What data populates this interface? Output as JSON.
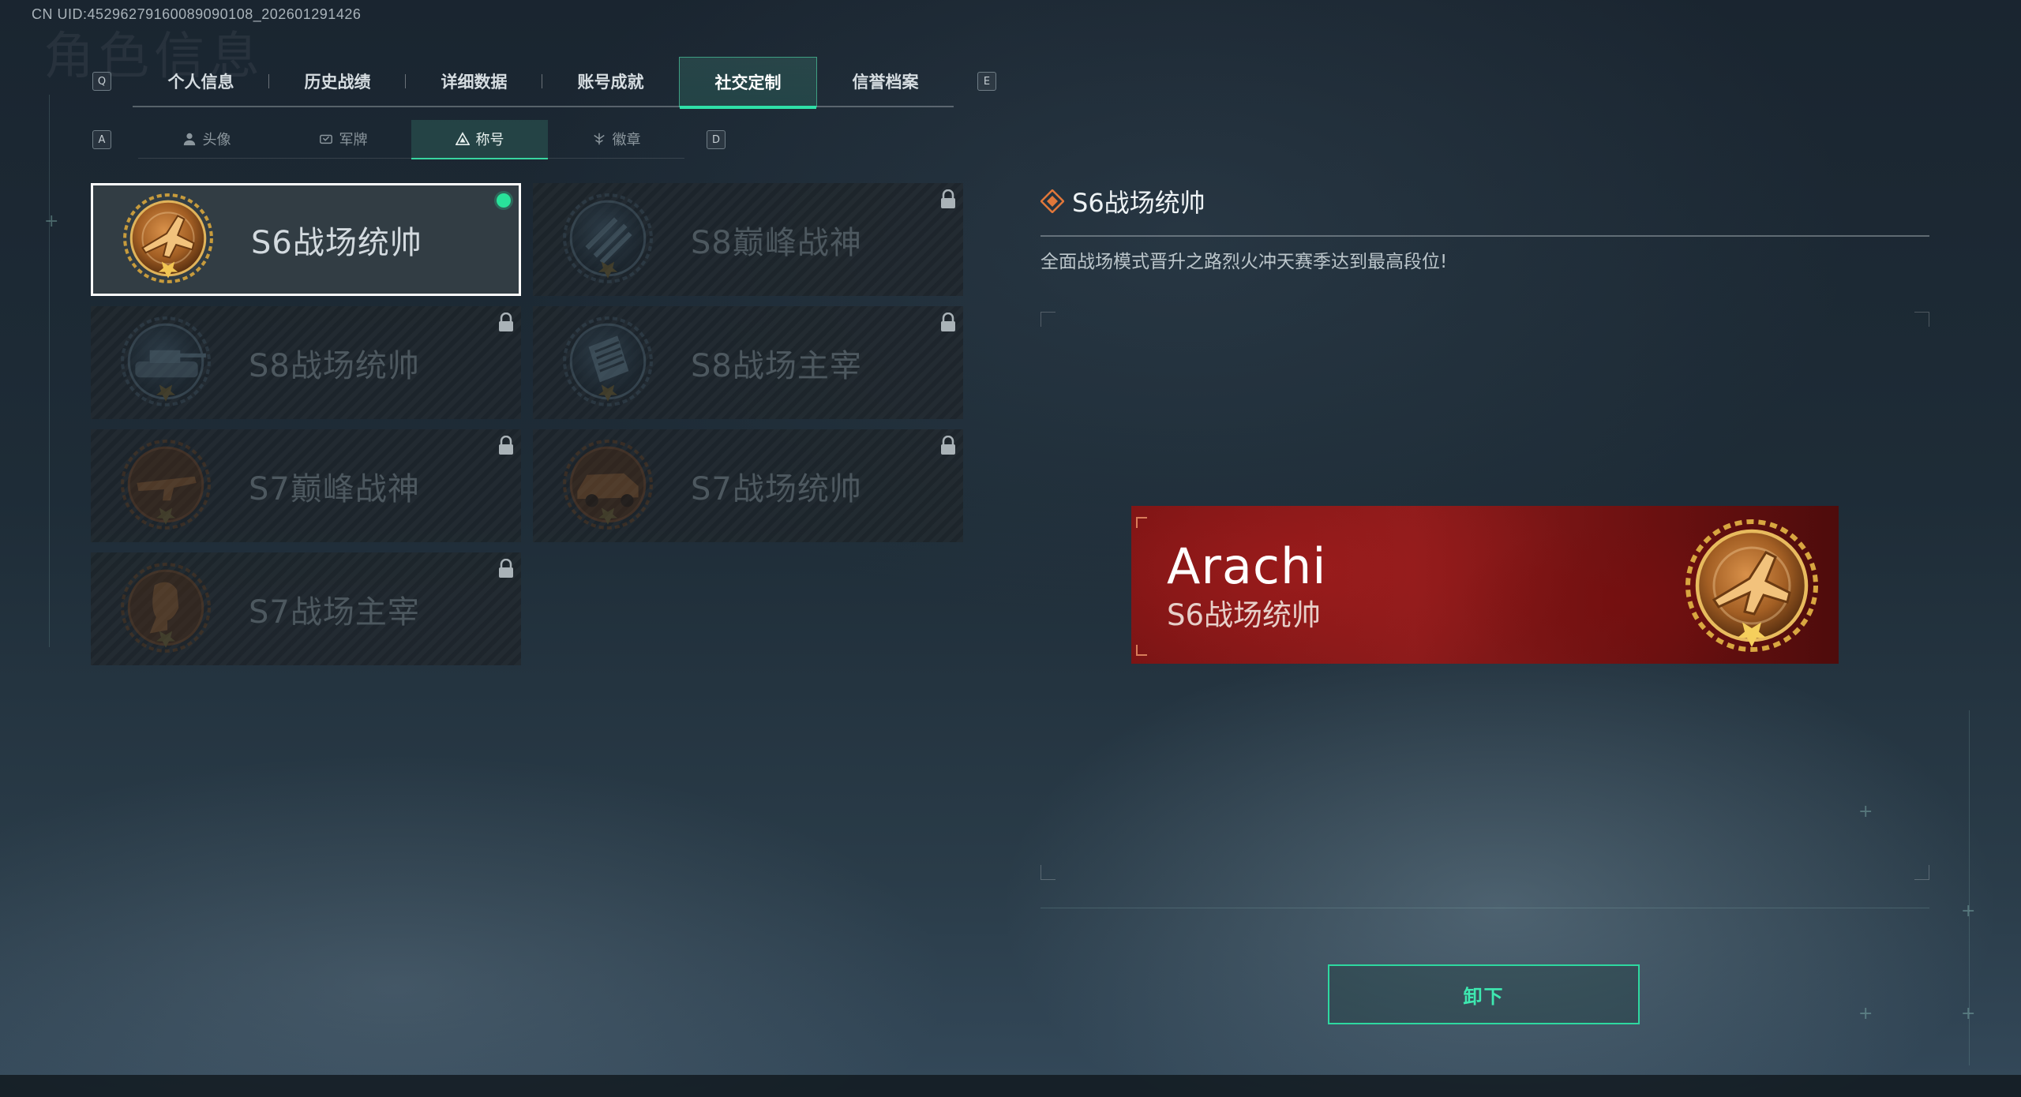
{
  "uid_text": "CN UID:4529627916008909010​8_202601291426",
  "watermark": "角色信息",
  "key_hints": {
    "prev_tab": "Q",
    "next_tab": "E",
    "prev_sub": "A",
    "next_sub": "D"
  },
  "tabs": [
    {
      "label": "个人信息"
    },
    {
      "label": "历史战绩"
    },
    {
      "label": "详细数据"
    },
    {
      "label": "账号成就"
    },
    {
      "label": "社交定制"
    },
    {
      "label": "信誉档案"
    }
  ],
  "subtabs": [
    {
      "label": "头像",
      "icon": "person-icon"
    },
    {
      "label": "军牌",
      "icon": "dogtag-icon"
    },
    {
      "label": "称号",
      "icon": "title-icon"
    },
    {
      "label": "徽章",
      "icon": "badge-icon"
    }
  ],
  "titles": [
    {
      "name": "S6战场统帅",
      "medal": "jet-medal-icon",
      "state": "equipped"
    },
    {
      "name": "S8巅峰战神",
      "medal": "helmet-medal-icon",
      "state": "locked"
    },
    {
      "name": "S8战场统帅",
      "medal": "tank-medal-icon",
      "state": "locked"
    },
    {
      "name": "S8战场主宰",
      "medal": "building-medal-icon",
      "state": "locked"
    },
    {
      "name": "S7巅峰战神",
      "medal": "gun-medal-icon",
      "state": "locked"
    },
    {
      "name": "S7战场统帅",
      "medal": "vehicle-medal-icon",
      "state": "locked"
    },
    {
      "name": "S7战场主宰",
      "medal": "soldier-medal-icon",
      "state": "locked"
    }
  ],
  "detail": {
    "title": "S6战场统帅",
    "description": "全面战场模式晋升之路烈火冲天赛季达到最高段位!"
  },
  "banner": {
    "player_name": "Arachi",
    "title": "S6战场统帅",
    "medal": "jet-medal-icon"
  },
  "unequip_button": "卸下",
  "colors": {
    "accent": "#2fe0a8",
    "equipped_dot": "#29e39a",
    "banner_red": "#8c1b1b",
    "medal_bronze": "#b8742e"
  }
}
